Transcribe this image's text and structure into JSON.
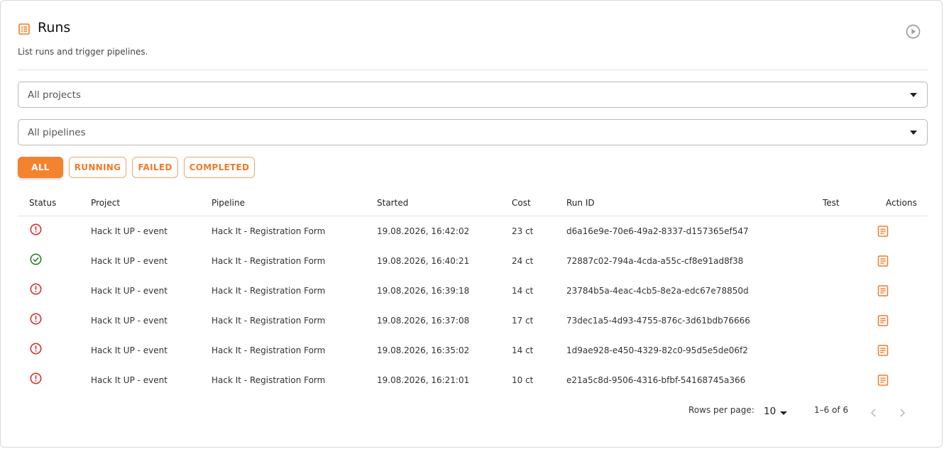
{
  "header": {
    "title": "Runs",
    "subtitle": "List runs and trigger pipelines.",
    "icon": "list-icon",
    "action_icon": "play-circle-icon"
  },
  "filters": {
    "project": "All projects",
    "pipeline": "All pipelines"
  },
  "status_tabs": [
    {
      "label": "ALL",
      "active": true
    },
    {
      "label": "RUNNING",
      "active": false
    },
    {
      "label": "FAILED",
      "active": false
    },
    {
      "label": "COMPLETED",
      "active": false
    }
  ],
  "table": {
    "headers": {
      "status": "Status",
      "project": "Project",
      "pipeline": "Pipeline",
      "started": "Started",
      "cost": "Cost",
      "run_id": "Run ID",
      "test": "Test",
      "actions": "Actions"
    },
    "rows": [
      {
        "status": "failed",
        "project": "Hack It UP - event",
        "pipeline": "Hack It - Registration Form",
        "started": "19.08.2026, 16:42:02",
        "cost": "23 ct",
        "run_id": "d6a16e9e-70e6-49a2-8337-d157365ef547",
        "test": ""
      },
      {
        "status": "completed",
        "project": "Hack It UP - event",
        "pipeline": "Hack It - Registration Form",
        "started": "19.08.2026, 16:40:21",
        "cost": "24 ct",
        "run_id": "72887c02-794a-4cda-a55c-cf8e91ad8f38",
        "test": ""
      },
      {
        "status": "failed",
        "project": "Hack It UP - event",
        "pipeline": "Hack It - Registration Form",
        "started": "19.08.2026, 16:39:18",
        "cost": "14 ct",
        "run_id": "23784b5a-4eac-4cb5-8e2a-edc67e78850d",
        "test": ""
      },
      {
        "status": "failed",
        "project": "Hack It UP - event",
        "pipeline": "Hack It - Registration Form",
        "started": "19.08.2026, 16:37:08",
        "cost": "17 ct",
        "run_id": "73dec1a5-4d93-4755-876c-3d61bdb76666",
        "test": ""
      },
      {
        "status": "failed",
        "project": "Hack It UP - event",
        "pipeline": "Hack It - Registration Form",
        "started": "19.08.2026, 16:35:02",
        "cost": "14 ct",
        "run_id": "1d9ae928-e450-4329-82c0-95d5e5de06f2",
        "test": ""
      },
      {
        "status": "failed",
        "project": "Hack It UP - event",
        "pipeline": "Hack It - Registration Form",
        "started": "19.08.2026, 16:21:01",
        "cost": "10 ct",
        "run_id": "e21a5c8d-9506-4316-bfbf-54168745a366",
        "test": ""
      }
    ]
  },
  "pagination": {
    "rows_per_page_label": "Rows per page:",
    "rows_per_page": "10",
    "range": "1–6 of 6"
  },
  "colors": {
    "accent": "#f3832f",
    "failed": "#d32f2f",
    "completed": "#2e7d32"
  }
}
